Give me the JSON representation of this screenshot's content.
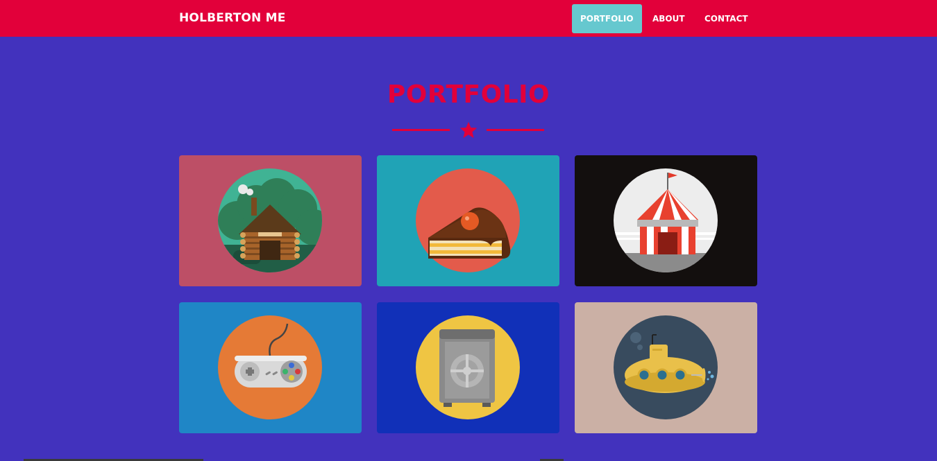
{
  "navbar": {
    "brand": "HOLBERTON ME",
    "items": [
      {
        "label": "PORTFOLIO"
      },
      {
        "label": "ABOUT"
      },
      {
        "label": "CONTACT"
      }
    ],
    "color": "#e2003a",
    "active_color": "#66c8cf"
  },
  "portfolio": {
    "title": "PORTFOLIO",
    "items": [
      {
        "icon": "log-cabin-icon",
        "bg": "#bd4f66"
      },
      {
        "icon": "cake-slice-icon",
        "bg": "#20a3b6"
      },
      {
        "icon": "circus-tent-icon",
        "bg": "#130f0e"
      },
      {
        "icon": "game-controller-icon",
        "bg": "#1f86c6"
      },
      {
        "icon": "safe-icon",
        "bg": "#1130b8"
      },
      {
        "icon": "submarine-icon",
        "bg": "#cbb0a5"
      }
    ]
  },
  "colors": {
    "background": "#4232bd",
    "accent": "#e2003a"
  }
}
